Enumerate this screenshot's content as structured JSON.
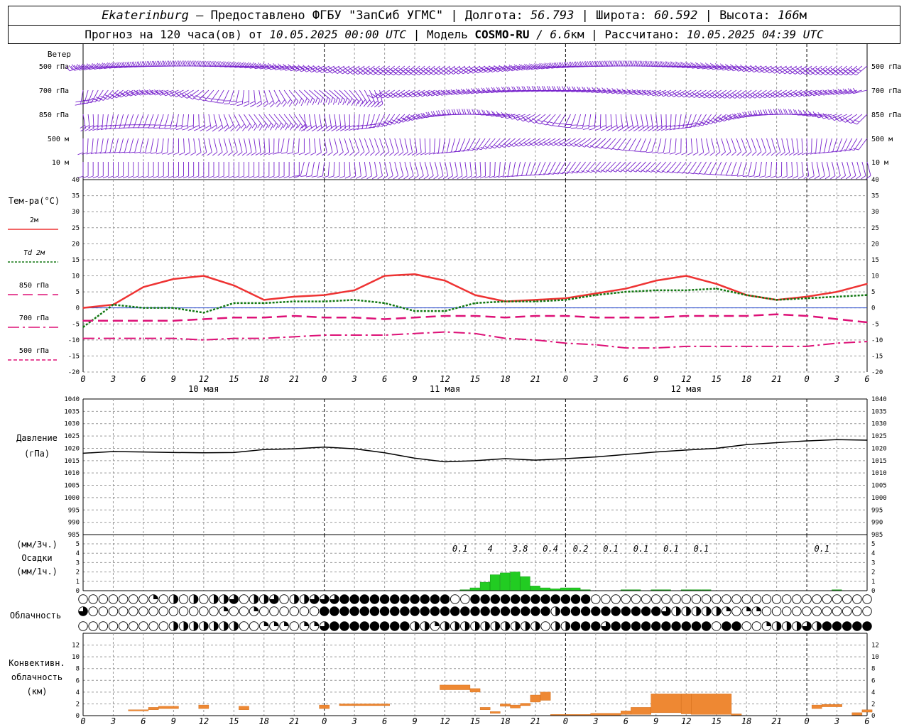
{
  "header": {
    "station": "Ekaterinburg",
    "provider": " — Предоставлено ФГБУ \"ЗапСиб УГМС\" | Долгота: ",
    "lon": "56.793",
    "lat_label": " | Широта: ",
    "lat": "60.592",
    "alt_label": " | Высота: ",
    "alt": "166",
    "alt_unit": "м",
    "forecast_label": "Прогноз на 120 часа(ов) от ",
    "forecast_start": "10.05.2025 00:00 UTC",
    "model_label": " | Модель ",
    "model": "COSMO-RU",
    "resolution": " / 6.6",
    "res_unit": "км",
    "calc_label": " | Рассчитано: ",
    "calc_time": "10.05.2025 04:39 UTC"
  },
  "wind_panel": {
    "title": "Ветер",
    "levels": [
      "500 гПа",
      "700 гПа",
      "850 гПа",
      "500 м",
      "10 м"
    ]
  },
  "temp_panel": {
    "title": "Тем-ра(°C)",
    "legend": [
      {
        "label": "2м",
        "color": "#ee3333",
        "style": "solid"
      },
      {
        "label": "Td 2м",
        "color": "#117711",
        "style": "dotted"
      },
      {
        "label": "850 гПа",
        "color": "#dd1177",
        "style": "dash"
      },
      {
        "label": "700 гПа",
        "color": "#dd1177",
        "style": "dashdot"
      },
      {
        "label": "500 гПа",
        "color": "#dd1177",
        "style": "finedash"
      }
    ]
  },
  "pressure_panel": {
    "title": "Давление",
    "unit": "(гПа)"
  },
  "precip_panel": {
    "unit_3h": "(мм/3ч.)",
    "title": "Осадки",
    "unit_1h": "(мм/1ч.)"
  },
  "cloud_panel": {
    "title": "Облачность"
  },
  "conv_panel": {
    "title": "Конвективн.",
    "title2": "облачность",
    "unit": "(км)"
  },
  "time_axis": {
    "hour_labels": [
      "0",
      "3",
      "6",
      "9",
      "12",
      "15",
      "18",
      "21",
      "0",
      "3",
      "6",
      "9",
      "12",
      "15",
      "18",
      "21",
      "0",
      "3",
      "6",
      "9",
      "12",
      "15",
      "18",
      "21",
      "0",
      "3",
      "6"
    ],
    "day_labels": [
      {
        "text": "10 мая",
        "hour": 12
      },
      {
        "text": "11 мая",
        "hour": 36
      },
      {
        "text": "12 мая",
        "hour": 60
      }
    ]
  },
  "chart_data": [
    {
      "type": "line",
      "title": "Тем-ра(°C)",
      "xlabel": "",
      "ylabel": "",
      "x_hours": [
        0,
        3,
        6,
        9,
        12,
        15,
        18,
        21,
        24,
        27,
        30,
        33,
        36,
        39,
        42,
        45,
        48,
        51,
        54,
        57,
        60,
        63,
        66,
        69,
        72,
        75,
        78
      ],
      "ylim": [
        -20,
        40
      ],
      "yticks": [
        -20,
        -15,
        -10,
        -5,
        0,
        5,
        10,
        15,
        20,
        25,
        30,
        35,
        40
      ],
      "series": [
        {
          "name": "2м",
          "color": "#ee3333",
          "values": [
            0,
            1,
            6.5,
            9,
            10,
            7,
            2.5,
            3.5,
            4,
            5.5,
            10,
            10.5,
            8.5,
            4,
            2,
            2.5,
            3,
            4.5,
            6,
            8.5,
            10,
            7.5,
            4,
            2.5,
            3.5,
            5,
            7.5
          ]
        },
        {
          "name": "Td 2м",
          "color": "#117711",
          "values": [
            -6,
            1,
            0,
            0,
            -1.5,
            1.5,
            1.5,
            2,
            2,
            2.5,
            1.5,
            -1,
            -1,
            1.5,
            2,
            2,
            2.5,
            4,
            5,
            5.5,
            5.5,
            6,
            4,
            2.5,
            3,
            3.5,
            4
          ]
        },
        {
          "name": "850 гПа",
          "color": "#dd1177",
          "values": [
            -4,
            -4,
            -4,
            -4,
            -3.5,
            -3,
            -3,
            -2.5,
            -3,
            -3,
            -3.5,
            -3,
            -2.5,
            -2.5,
            -3,
            -2.5,
            -2.5,
            -3,
            -3,
            -3,
            -2.5,
            -2.5,
            -2.5,
            -2,
            -2.5,
            -3.5,
            -4.5
          ]
        },
        {
          "name": "700 гПа",
          "color": "#dd1177",
          "values": [
            -9.5,
            -9.5,
            -9.5,
            -9.5,
            -10,
            -9.5,
            -9.5,
            -9,
            -8.5,
            -8.5,
            -8.5,
            -8,
            -7.5,
            -8,
            -9.5,
            -10,
            -11,
            -11.5,
            -12.5,
            -12.5,
            -12,
            -12,
            -12,
            -12,
            -12,
            -11,
            -10.5
          ]
        }
      ]
    },
    {
      "type": "line",
      "title": "Давление",
      "xlabel": "",
      "ylabel": "(гПа)",
      "x_hours": [
        0,
        3,
        6,
        9,
        12,
        15,
        18,
        21,
        24,
        27,
        30,
        33,
        36,
        39,
        42,
        45,
        48,
        51,
        54,
        57,
        60,
        63,
        66,
        69,
        72,
        75,
        78
      ],
      "ylim": [
        985,
        1040
      ],
      "yticks": [
        985,
        990,
        995,
        1000,
        1005,
        1010,
        1015,
        1020,
        1025,
        1030,
        1035,
        1040
      ],
      "series": [
        {
          "name": "",
          "color": "#000000",
          "values": [
            1018,
            1018.7,
            1018.5,
            1018.3,
            1018.2,
            1018.3,
            1019.5,
            1019.8,
            1020.5,
            1019.8,
            1018.2,
            1016,
            1014.5,
            1015,
            1015.8,
            1015.2,
            1015.8,
            1016.5,
            1017.5,
            1018.5,
            1019.3,
            1020,
            1021.5,
            1022.3,
            1023,
            1023.5,
            1023.3
          ]
        }
      ]
    },
    {
      "type": "bar",
      "title": "Осадки",
      "xlabel": "",
      "ylabel": "(мм/1ч.)",
      "ylim": [
        0,
        5
      ],
      "yticks": [
        0,
        1,
        2,
        3,
        4,
        5
      ],
      "x_hours": [
        38,
        39,
        40,
        41,
        42,
        43,
        44,
        45,
        46,
        47,
        48,
        49,
        50,
        54,
        55,
        57,
        58,
        60,
        61,
        62,
        75
      ],
      "values": [
        0.1,
        0.3,
        0.9,
        1.7,
        1.9,
        2.0,
        1.5,
        0.5,
        0.3,
        0.2,
        0.3,
        0.3,
        0.1,
        0.1,
        0.1,
        0.1,
        0.1,
        0.1,
        0.1,
        0.1,
        0.1
      ],
      "totals_3h": [
        {
          "hour": 37.5,
          "text": "0.1"
        },
        {
          "hour": 40.5,
          "text": "4"
        },
        {
          "hour": 43.5,
          "text": "3.8"
        },
        {
          "hour": 46.5,
          "text": "0.4"
        },
        {
          "hour": 49.5,
          "text": "0.2"
        },
        {
          "hour": 52.5,
          "text": "0.1"
        },
        {
          "hour": 55.5,
          "text": "0.1"
        },
        {
          "hour": 58.5,
          "text": "0.1"
        },
        {
          "hour": 61.5,
          "text": "0.1"
        },
        {
          "hour": 73.5,
          "text": "0.1"
        }
      ]
    },
    {
      "type": "heatmap",
      "title": "Облачность",
      "rows": 3,
      "cols": 79,
      "scale": "fraction 0..1 per hour",
      "rows_values": [
        [
          0,
          0,
          0,
          0,
          0,
          0,
          0,
          0.25,
          0,
          0.5,
          0,
          0.5,
          0,
          0.5,
          0.5,
          0.75,
          0,
          0.5,
          0.5,
          0.75,
          0,
          0.5,
          0.5,
          0.75,
          0.75,
          0.75,
          1,
          1,
          1,
          1,
          1,
          1,
          1,
          1,
          1,
          1,
          1,
          0,
          0,
          1,
          1,
          1,
          1,
          1,
          1,
          1,
          1,
          1,
          1,
          1,
          1,
          0,
          0,
          0,
          0,
          0,
          0,
          0,
          0,
          0,
          0,
          0,
          0,
          0,
          0,
          0,
          0,
          0,
          0,
          0,
          0,
          0,
          0,
          0,
          0,
          0,
          0,
          0,
          0
        ],
        [
          0.75,
          0,
          0,
          0,
          0,
          0,
          0,
          0,
          0,
          0,
          0,
          0,
          0,
          0,
          0.25,
          0,
          0,
          0.25,
          0,
          0,
          0,
          0,
          0,
          0,
          1,
          1,
          1,
          1,
          1,
          1,
          1,
          1,
          1,
          1,
          1,
          1,
          1,
          1,
          1,
          1,
          1,
          1,
          1,
          1,
          1,
          1,
          1,
          0.5,
          1,
          1,
          1,
          1,
          1,
          1,
          1,
          1,
          1,
          1,
          0.75,
          0.5,
          0.5,
          0.5,
          0.5,
          0.5,
          0.25,
          0,
          0.25,
          0.25,
          0,
          0,
          0,
          0,
          0,
          0,
          0,
          0,
          0,
          0,
          0
        ],
        [
          0,
          0,
          0,
          0,
          0,
          0,
          0,
          0,
          0,
          0.5,
          0.5,
          0.5,
          0.5,
          0.5,
          0.5,
          0.5,
          0,
          0,
          0.25,
          0.25,
          0.25,
          0,
          0.25,
          0.25,
          0.75,
          1,
          1,
          1,
          1,
          1,
          1,
          1,
          1,
          0.5,
          0.5,
          0.25,
          0.5,
          0.5,
          0.5,
          0.5,
          0.5,
          0.5,
          0.5,
          0.5,
          0.5,
          0.5,
          0,
          0.5,
          0.5,
          1,
          1,
          1,
          0.75,
          1,
          1,
          1,
          1,
          1,
          1,
          1,
          1,
          1,
          1,
          0,
          1,
          1,
          0,
          0,
          0.25,
          0.5,
          0.5,
          0.5,
          0.75,
          0.5,
          1,
          1,
          1,
          1,
          1
        ]
      ]
    },
    {
      "type": "bar",
      "title": "Конвективн. облачность",
      "xlabel": "",
      "ylabel": "(км)",
      "ylim": [
        0,
        14
      ],
      "yticks": [
        0,
        2,
        4,
        6,
        8,
        10,
        12
      ],
      "segments": [
        {
          "start": 4.5,
          "end": 6.5,
          "bottom": 0.8,
          "top": 1.0
        },
        {
          "start": 6.5,
          "end": 7.5,
          "bottom": 1.0,
          "top": 1.4
        },
        {
          "start": 7.5,
          "end": 9.5,
          "bottom": 1.2,
          "top": 1.6
        },
        {
          "start": 11.5,
          "end": 12.5,
          "bottom": 1.2,
          "top": 1.8
        },
        {
          "start": 15.5,
          "end": 16.5,
          "bottom": 1.0,
          "top": 1.6
        },
        {
          "start": 23.5,
          "end": 24.5,
          "bottom": 1.2,
          "top": 1.8
        },
        {
          "start": 25.5,
          "end": 30.5,
          "bottom": 1.7,
          "top": 2.0
        },
        {
          "start": 35.5,
          "end": 38.5,
          "bottom": 4.4,
          "top": 5.2
        },
        {
          "start": 38.5,
          "end": 39.5,
          "bottom": 4.0,
          "top": 4.6
        },
        {
          "start": 39.5,
          "end": 40.5,
          "bottom": 1.0,
          "top": 1.4
        },
        {
          "start": 40.5,
          "end": 41.5,
          "bottom": 0.4,
          "top": 0.7
        },
        {
          "start": 41.5,
          "end": 42.5,
          "bottom": 1.6,
          "top": 2.0
        },
        {
          "start": 42.5,
          "end": 43.5,
          "bottom": 1.3,
          "top": 1.8
        },
        {
          "start": 43.5,
          "end": 44.5,
          "bottom": 1.7,
          "top": 2.1
        },
        {
          "start": 44.5,
          "end": 45.5,
          "bottom": 2.3,
          "top": 3.5
        },
        {
          "start": 45.5,
          "end": 46.5,
          "bottom": 2.6,
          "top": 4.0
        },
        {
          "start": 46.5,
          "end": 50.5,
          "bottom": 0.0,
          "top": 0.2
        },
        {
          "start": 50.5,
          "end": 53.5,
          "bottom": 0.0,
          "top": 0.4
        },
        {
          "start": 53.5,
          "end": 54.5,
          "bottom": 0.2,
          "top": 0.8
        },
        {
          "start": 54.5,
          "end": 56.5,
          "bottom": 0.2,
          "top": 1.4
        },
        {
          "start": 56.5,
          "end": 59.5,
          "bottom": 0.5,
          "top": 3.7
        },
        {
          "start": 59.5,
          "end": 60.5,
          "bottom": 0.3,
          "top": 3.7
        },
        {
          "start": 60.5,
          "end": 64.5,
          "bottom": 0.2,
          "top": 3.7
        },
        {
          "start": 64.5,
          "end": 65.5,
          "bottom": 0.0,
          "top": 0.3
        },
        {
          "start": 72.5,
          "end": 73.5,
          "bottom": 1.2,
          "top": 1.8
        },
        {
          "start": 73.5,
          "end": 75.5,
          "bottom": 1.5,
          "top": 1.9
        },
        {
          "start": 76.5,
          "end": 77.5,
          "bottom": 0.1,
          "top": 0.5
        },
        {
          "start": 77.5,
          "end": 78.5,
          "bottom": 0.6,
          "top": 1.0
        }
      ]
    }
  ],
  "colors": {
    "wind": "#7722cc",
    "precip": "#22cc22",
    "conv": "#ee8833",
    "grid": "#999999"
  }
}
